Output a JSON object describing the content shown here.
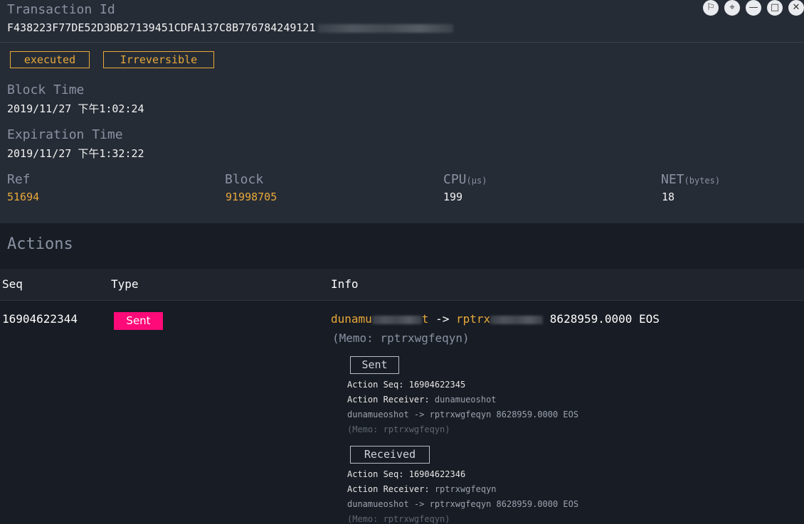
{
  "window": {
    "buttons": [
      {
        "name": "shirt-icon",
        "glyph": "⚐"
      },
      {
        "name": "pin-icon",
        "glyph": "⌖"
      },
      {
        "name": "minimize-icon",
        "glyph": "—"
      },
      {
        "name": "maximize-icon",
        "glyph": "□"
      },
      {
        "name": "close-icon",
        "glyph": "✕"
      }
    ]
  },
  "transaction": {
    "id_label": "Transaction Id",
    "id_value": "F438223F77DE52D3DB27139451CDFA137C8B776784249121",
    "status_badges": [
      "executed",
      "Irreversible"
    ],
    "block_time_label": "Block Time",
    "block_time_value": "2019/11/27 下午1:02:24",
    "expiration_label": "Expiration Time",
    "expiration_value": "2019/11/27 下午1:32:22",
    "ref_label": "Ref",
    "ref_value": "51694",
    "block_label": "Block",
    "block_value": "91998705",
    "cpu_label": "CPU",
    "cpu_unit": "(µs)",
    "cpu_value": "199",
    "net_label": "NET",
    "net_unit": "(bytes)",
    "net_value": "18"
  },
  "actions": {
    "title": "Actions",
    "columns": [
      "Seq",
      "Type",
      "Info"
    ],
    "row": {
      "seq": "16904622344",
      "type": "Sent",
      "from": "dunamu",
      "from_tail": "t",
      "arrow": "->",
      "to": "rptrx",
      "amount": "8628959.0000 EOS",
      "memo": "(Memo: rptrxwgfeqyn)"
    },
    "sub_actions": [
      {
        "box": "Sent",
        "seq_label": "Action Seq:",
        "seq_value": "16904622345",
        "receiver_label": "Action Receiver:",
        "receiver_value": "dunamueoshot",
        "transfer_line": "dunamueoshot -> rptrxwgfeqyn 8628959.0000 EOS",
        "memo": "(Memo: rptrxwgfeqyn)"
      },
      {
        "box": "Received",
        "seq_label": "Action Seq:",
        "seq_value": "16904622346",
        "receiver_label": "Action Receiver:",
        "receiver_value": "rptrxwgfeqyn",
        "transfer_line": "dunamueoshot -> rptrxwgfeqyn 8628959.0000 EOS",
        "memo": "(Memo: rptrxwgfeqyn)"
      }
    ]
  }
}
